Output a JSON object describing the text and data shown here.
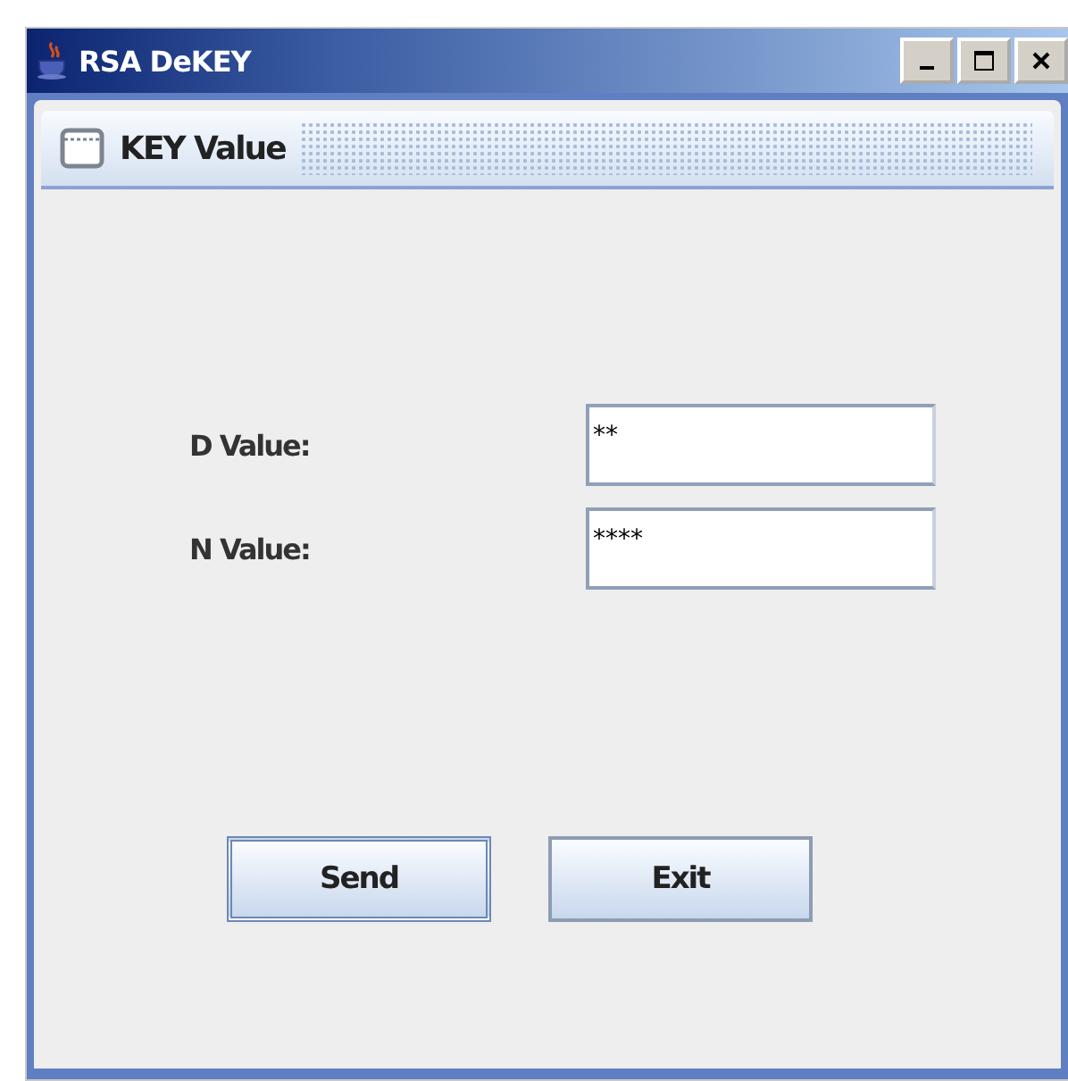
{
  "window": {
    "title": "RSA DeKEY"
  },
  "frame": {
    "title": "KEY Value"
  },
  "fields": [
    {
      "label": "D Value:",
      "value": "**"
    },
    {
      "label": "N Value:",
      "value": "****"
    }
  ],
  "buttons": [
    {
      "label": "Send",
      "focused": true
    },
    {
      "label": "Exit",
      "focused": false
    }
  ]
}
